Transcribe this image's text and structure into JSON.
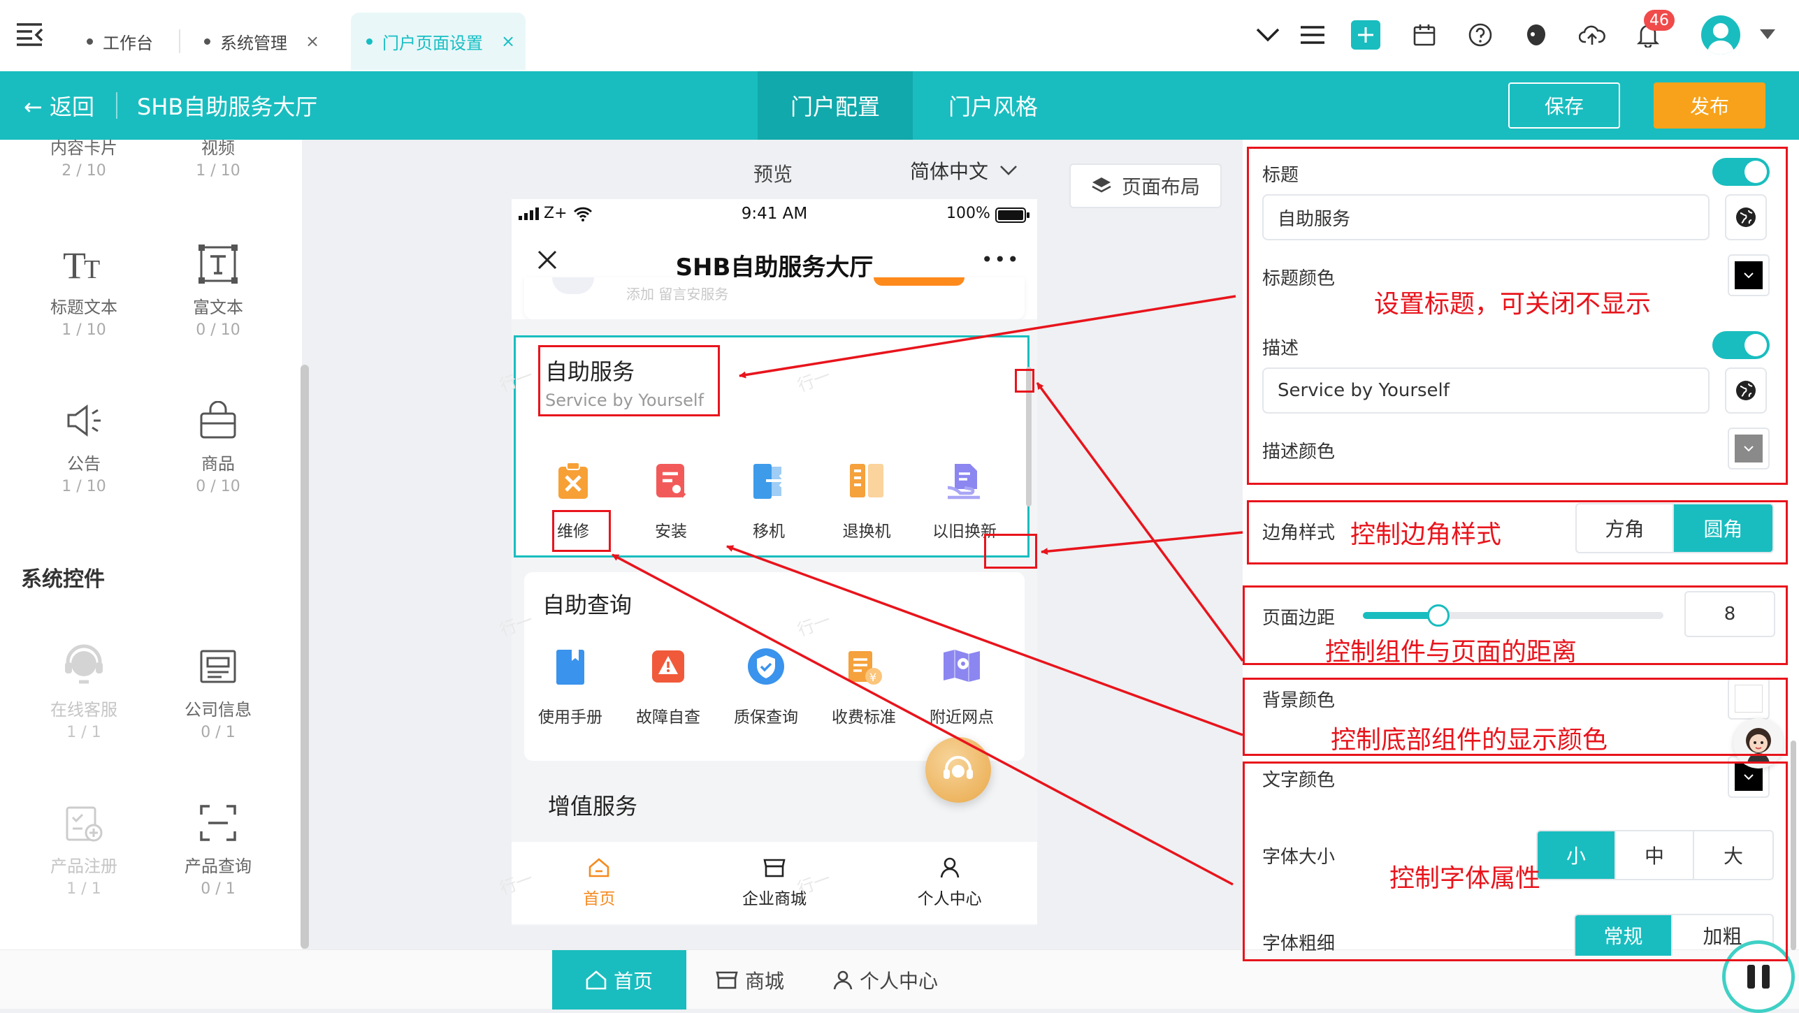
{
  "topbar": {
    "tabs": [
      {
        "label": "工作台",
        "closable": false
      },
      {
        "label": "系统管理",
        "closable": true
      },
      {
        "label": "门户页面设置",
        "closable": true,
        "active": true
      }
    ],
    "close_glyph": "×",
    "notification_count": "46",
    "icons": [
      "chevron-down-icon",
      "menu-icon",
      "add-icon",
      "calendar-icon",
      "help-icon",
      "skin-icon",
      "cloud-upload-icon",
      "bell-icon",
      "avatar",
      "caret-down-icon"
    ]
  },
  "header": {
    "back": "← 返回",
    "portal_name": "SHB自助服务大厅",
    "tabs": [
      "门户配置",
      "门户风格"
    ],
    "save": "保存",
    "publish": "发布"
  },
  "left_panel": {
    "partial_row": [
      {
        "label": "内容卡片",
        "count": "2 / 10"
      },
      {
        "label": "视频",
        "count": "1 / 10"
      }
    ],
    "basic_components": [
      {
        "label": "标题文本",
        "count": "1 / 10",
        "icon": "title-text-icon"
      },
      {
        "label": "富文本",
        "count": "0 / 10",
        "icon": "rich-text-icon"
      },
      {
        "label": "公告",
        "count": "1 / 10",
        "icon": "announcement-icon"
      },
      {
        "label": "商品",
        "count": "0 / 10",
        "icon": "product-bag-icon"
      }
    ],
    "system_section_title": "系统控件",
    "system_components": [
      {
        "label": "在线客服",
        "count": "1 / 1",
        "icon": "customer-service-icon",
        "disabled": true
      },
      {
        "label": "公司信息",
        "count": "0 / 1",
        "icon": "company-info-icon",
        "disabled": false
      },
      {
        "label": "产品注册",
        "count": "1 / 1",
        "icon": "product-register-icon",
        "disabled": true
      },
      {
        "label": "产品查询",
        "count": "0 / 1",
        "icon": "product-query-icon",
        "disabled": false
      }
    ]
  },
  "preview_bar": {
    "label": "预览",
    "language": "简体中文",
    "layout_button": "页面布局"
  },
  "phone": {
    "status_left": "Z+",
    "time": "9:41 AM",
    "battery": "100%",
    "title": "SHB自助服务大厅",
    "more": "•••",
    "faded_text": "添加  留言安服务",
    "section1": {
      "title": "自助服务",
      "desc": "Service by Yourself",
      "items": [
        {
          "label": "维修",
          "icon": "repair-icon",
          "color": "#f7a035"
        },
        {
          "label": "安装",
          "icon": "install-icon",
          "color": "#f25a5a"
        },
        {
          "label": "移机",
          "icon": "relocate-icon",
          "color": "#3d9bea"
        },
        {
          "label": "退换机",
          "icon": "exchange-icon",
          "color": "#f5a13c"
        },
        {
          "label": "以旧换新",
          "icon": "trade-in-icon",
          "color": "#8b86f0"
        }
      ]
    },
    "section2": {
      "title": "自助查询",
      "items": [
        {
          "label": "使用手册",
          "icon": "manual-icon",
          "color": "#3a93ec"
        },
        {
          "label": "故障自查",
          "icon": "fault-check-icon",
          "color": "#f05a3a"
        },
        {
          "label": "质保查询",
          "icon": "warranty-icon",
          "color": "#3a93ec"
        },
        {
          "label": "收费标准",
          "icon": "fee-icon",
          "color": "#f5a13c"
        },
        {
          "label": "附近网点",
          "icon": "nearby-icon",
          "color": "#8b86f0"
        }
      ]
    },
    "section3": {
      "title": "增值服务"
    },
    "tabbar": [
      {
        "label": "首页",
        "icon": "home-icon",
        "active": true
      },
      {
        "label": "企业商城",
        "icon": "shop-icon",
        "active": false
      },
      {
        "label": "个人中心",
        "icon": "user-icon",
        "active": false
      }
    ],
    "watermark": "行一"
  },
  "bottom_nav": [
    {
      "label": "首页",
      "icon": "home-icon",
      "active": true
    },
    {
      "label": "商城",
      "icon": "shop-icon",
      "active": false
    },
    {
      "label": "个人中心",
      "icon": "user-icon",
      "active": false
    }
  ],
  "settings": {
    "title_label": "标题",
    "title_value": "自助服务",
    "title_color_label": "标题颜色",
    "desc_label": "描述",
    "desc_value": "Service by Yourself",
    "desc_color_label": "描述颜色",
    "corner_label": "边角样式",
    "corner_options": [
      "方角",
      "圆角"
    ],
    "corner_selected": "圆角",
    "margin_label": "页面边距",
    "margin_value": "8",
    "margin_fraction": 0.25,
    "bg_color_label": "背景颜色",
    "text_color_label": "文字颜色",
    "font_size_label": "字体大小",
    "font_size_options": [
      "小",
      "中",
      "大"
    ],
    "font_size_selected": "小",
    "font_weight_label": "字体粗细",
    "font_weight_options": [
      "常规",
      "加粗"
    ],
    "font_weight_selected": "常规"
  },
  "annotations": [
    "设置标题，可关闭不显示",
    "控制边角样式",
    "控制组件与页面的距离",
    "控制底部组件的显示颜色",
    "控制字体属性"
  ],
  "colors": {
    "brand": "#19bdbf",
    "publish": "#f7a21a",
    "annotation": "#e8141c",
    "badge": "#f04a4a"
  }
}
